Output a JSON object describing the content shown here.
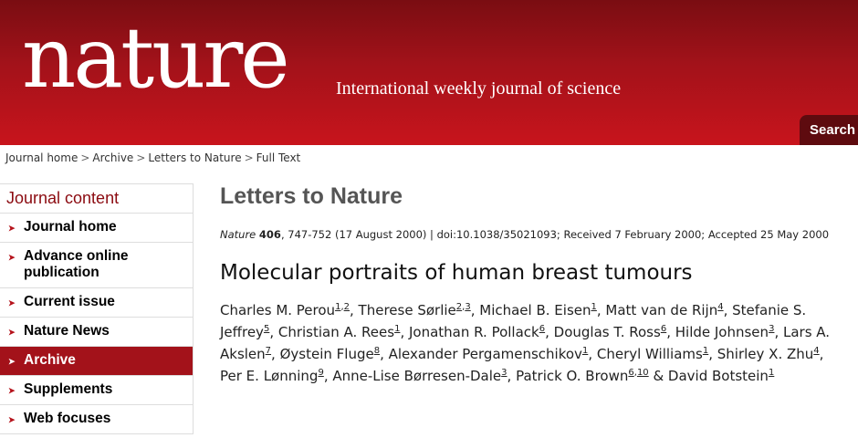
{
  "header": {
    "logo": "nature",
    "tagline": "International weekly journal of science",
    "search_label": "Search"
  },
  "breadcrumb": [
    "Journal home",
    "Archive",
    "Letters to Nature",
    "Full Text"
  ],
  "breadcrumb_sep": ">",
  "sidebar": {
    "heading": "Journal content",
    "items": [
      {
        "label": "Journal home"
      },
      {
        "label": "Advance online publication"
      },
      {
        "label": "Current issue"
      },
      {
        "label": "Nature News"
      },
      {
        "label": "Archive",
        "active": true
      },
      {
        "label": "Supplements"
      },
      {
        "label": "Web focuses"
      }
    ]
  },
  "main": {
    "section_title": "Letters to Nature",
    "citation": {
      "journal": "Nature",
      "volume": "406",
      "rest": ", 747-752 (17 August 2000) | doi:10.1038/35021093; Received 7 February 2000; Accepted 25 May 2000"
    },
    "article_title": "Molecular portraits of human breast tumours",
    "authors": [
      {
        "name": "Charles M. Perou",
        "refs": [
          "1",
          "2"
        ]
      },
      {
        "name": "Therese Sørlie",
        "refs": [
          "2",
          "3"
        ]
      },
      {
        "name": "Michael B. Eisen",
        "refs": [
          "1"
        ]
      },
      {
        "name": "Matt van de Rijn",
        "refs": [
          "4"
        ]
      },
      {
        "name": "Stefanie S. Jeffrey",
        "refs": [
          "5"
        ]
      },
      {
        "name": "Christian A. Rees",
        "refs": [
          "1"
        ]
      },
      {
        "name": "Jonathan R. Pollack",
        "refs": [
          "6"
        ]
      },
      {
        "name": "Douglas T. Ross",
        "refs": [
          "6"
        ]
      },
      {
        "name": "Hilde Johnsen",
        "refs": [
          "3"
        ]
      },
      {
        "name": "Lars A. Akslen",
        "refs": [
          "7"
        ]
      },
      {
        "name": "Øystein Fluge",
        "refs": [
          "8"
        ]
      },
      {
        "name": "Alexander Pergamenschikov",
        "refs": [
          "1"
        ]
      },
      {
        "name": "Cheryl Williams",
        "refs": [
          "1"
        ]
      },
      {
        "name": "Shirley X. Zhu",
        "refs": [
          "4"
        ]
      },
      {
        "name": "Per E. Lønning",
        "refs": [
          "9"
        ]
      },
      {
        "name": "Anne-Lise Børresen-Dale",
        "refs": [
          "3"
        ]
      },
      {
        "name": "Patrick O. Brown",
        "refs": [
          "6",
          "10"
        ]
      },
      {
        "name": "David Botstein",
        "refs": [
          "1"
        ]
      }
    ],
    "last_joiner": " & "
  },
  "colors": {
    "brand_red": "#b5121b",
    "dark_red": "#7a0d12",
    "heading_red": "#8b0a10"
  }
}
